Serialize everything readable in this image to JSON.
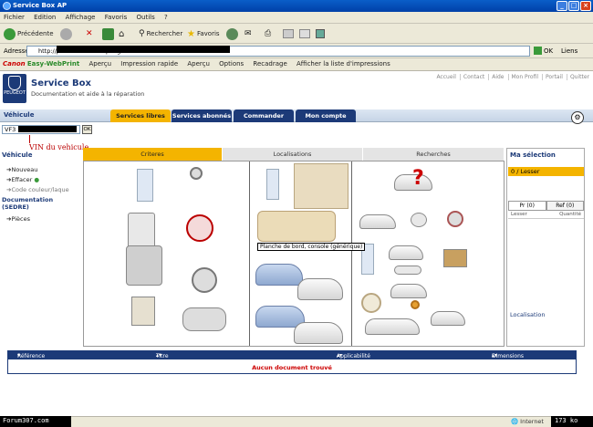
{
  "browser": {
    "title": "Service Box AP",
    "menu": [
      "Fichier",
      "Edition",
      "Affichage",
      "Favoris",
      "Outils",
      "?"
    ],
    "toolbar": {
      "back": "Précédente",
      "search": "Rechercher",
      "favorites": "Favoris"
    },
    "address": {
      "label": "Adresse",
      "value": "http://publ...ervicebox.peugeot...",
      "go": "OK",
      "links": "Liens"
    },
    "canon": {
      "brand": "Canon",
      "product": "Easy-WebPrint",
      "items": [
        "Aperçu",
        "Impression rapide",
        "Aperçu",
        "Options",
        "Recadrage",
        "Afficher la liste d'impressions"
      ]
    }
  },
  "app": {
    "logo_text": "PEUGEOT",
    "title": "Service Box",
    "subtitle": "Documentation et aide à la réparation",
    "top_links": [
      "Accueil",
      "Contact",
      "Aide",
      "Mon Profil",
      "Portail",
      "Quitter"
    ],
    "nav": {
      "vehicle_label": "Véhicule",
      "tabs": [
        {
          "label": "Services libres",
          "color": "#f4b400"
        },
        {
          "label": "Services abonnés",
          "color": "#1c3a78"
        },
        {
          "label": "Commander",
          "color": "#1c3a78"
        },
        {
          "label": "Mon compte",
          "color": "#1c3a78"
        }
      ]
    },
    "vin": {
      "value": "VF3",
      "button": "OK",
      "annotation": "VIN du vehicule"
    },
    "left": {
      "heading": "Véhicule",
      "items": [
        "Nouveau",
        "Effacer",
        "Code couleur/laque"
      ],
      "section2": "Documentation (SEDRE)",
      "items2": [
        "Pièces"
      ]
    },
    "catalog_tabs": [
      {
        "label": "Criteres",
        "active": true
      },
      {
        "label": "Localisations",
        "active": false
      },
      {
        "label": "Recherches",
        "active": false
      }
    ],
    "tooltip": "Planche de bord, console (générique)",
    "right": {
      "heading": "Ma sélection",
      "bar": "0 / Lesser",
      "tabs": [
        "Pr (0)",
        "Ref (0)"
      ],
      "headers": [
        "Lesser",
        "Quantité"
      ],
      "bottom": "Localisation"
    },
    "results": {
      "headers": [
        "Référence",
        "Titre",
        "Applicabilité",
        "Dimensions"
      ],
      "empty": "Aucun document trouvé"
    }
  },
  "status": {
    "left_overlay": "Forum307.com",
    "zone": "Internet",
    "size": "173 ko"
  }
}
